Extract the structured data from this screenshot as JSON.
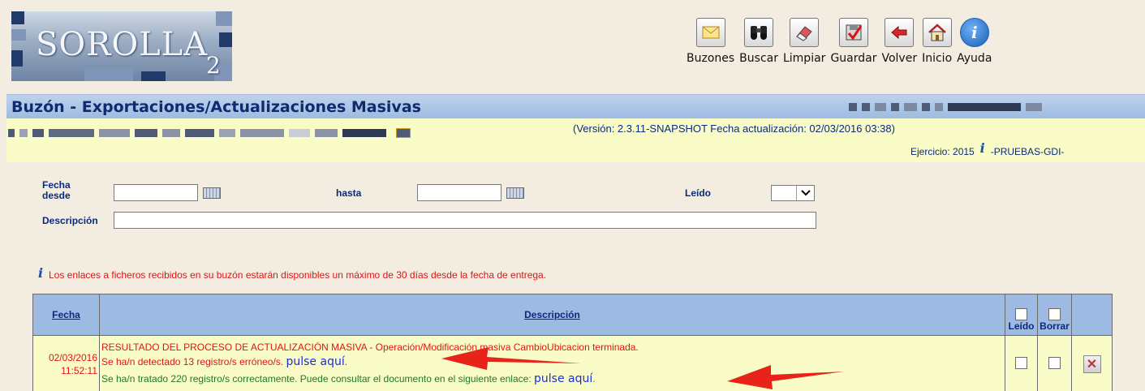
{
  "app": {
    "logo_text": "SOROLLA",
    "logo_sub": "2"
  },
  "toolbar": {
    "items": [
      {
        "label": "Buzones",
        "icon": "mail-icon"
      },
      {
        "label": "Buscar",
        "icon": "binoculars-icon"
      },
      {
        "label": "Limpiar",
        "icon": "eraser-icon"
      },
      {
        "label": "Guardar",
        "icon": "save-check-icon"
      },
      {
        "label": "Volver",
        "icon": "back-arrow-icon"
      },
      {
        "label": "Inicio",
        "icon": "home-icon"
      },
      {
        "label": "Ayuda",
        "icon": "info-icon"
      }
    ]
  },
  "title": "Buzón - Exportaciones/Actualizaciones Masivas",
  "info": {
    "version": "(Versión: 2.3.11-SNAPSHOT Fecha actualización: 02/03/2016 03:38)",
    "ejercicio_prefix": "Ejercicio: 2015",
    "ejercicio_suffix": "-PRUEBAS-GDI-"
  },
  "filters": {
    "fecha_desde_label_1": "Fecha",
    "fecha_desde_label_2": "desde",
    "fecha_desde_value": "",
    "hasta_label": "hasta",
    "hasta_value": "",
    "leido_label": "Leído",
    "leido_value": "",
    "descripcion_label": "Descripción",
    "descripcion_value": ""
  },
  "notice": "Los enlaces a ficheros recibidos en su buzón estarán disponibles un máximo de 30 días desde la fecha de entrega.",
  "table": {
    "headers": {
      "fecha": "Fecha",
      "descripcion": "Descripción",
      "leido": "Leído",
      "borrar": "Borrar"
    },
    "rows": [
      {
        "date": "02/03/2016",
        "time": "11:52:11",
        "line1": "RESULTADO DEL PROCESO DE ACTUALIZACIÓN MASIVA - Operación/Modificación masiva CambioUbicacion terminada.",
        "line2": "Se ha/n detectado 13 registro/s erróneo/s.",
        "line2_link": "pulse aquí",
        "line3": "Se ha/n tratado 220 registro/s correctamente. Puede consultar el documento en el siguiente enlace:",
        "line3_link": "pulse aquí",
        "leido": false,
        "borrar": false
      }
    ]
  },
  "colors": {
    "background": "#f3ece0",
    "titlebar": "#9dbbe2",
    "infobar": "#fafcc8",
    "error_text": "#e01414",
    "ok_text": "#1f7a1f",
    "link": "#1d2fd1",
    "annotation_arrow": "#e8231a"
  }
}
